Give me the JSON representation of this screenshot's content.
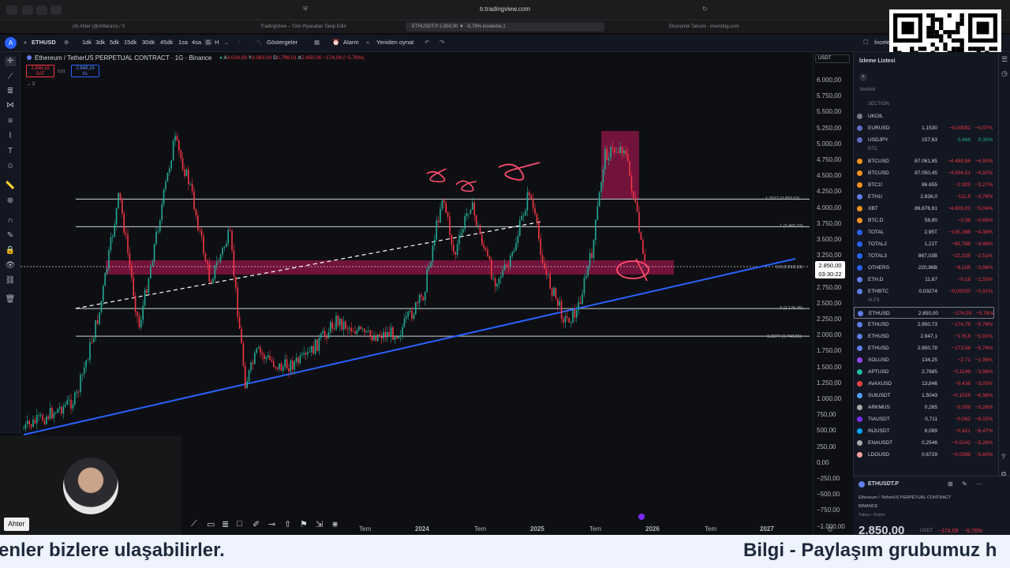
{
  "browser": {
    "url": "tr.tradingview.com",
    "tabs": [
      {
        "label": "(4) Ahter (@Ahterars) / X"
      },
      {
        "label": "TradingView – Tüm Piyasaları Takip Edin"
      },
      {
        "label": "ETHUSDT.P 2.850,00 ▼ −5,76% inceleme 2"
      },
      {
        "label": "Ekonomik Takvim - investing.com"
      }
    ]
  },
  "toolbar": {
    "symbol": "ETHUSD",
    "intervals": [
      "1dk",
      "3dk",
      "5dk",
      "15dk",
      "30dk",
      "45dk",
      "1sa",
      "4sa",
      "G",
      "H"
    ],
    "selected_interval": "G",
    "indicators_label": "Göstergeler",
    "alarm_label": "Alarm",
    "replay_label": "Yeniden oynat",
    "right_label": "İnceleme 2"
  },
  "legend": {
    "title": "Ethereum / TetherUS PERPETUAL CONTRACT · 1G · Binance",
    "ohlc": [
      {
        "k": "A",
        "v": "3.024,09"
      },
      {
        "k": "Y",
        "v": "3.063,00"
      },
      {
        "k": "D",
        "v": "2.798,01"
      },
      {
        "k": "K",
        "v": "2.850,00"
      }
    ],
    "change": "−174,09 (−5,76%)",
    "sell_price": "2.848,16",
    "sell_label": "SAT",
    "spread": "0,01",
    "buy_price": "2.848,16",
    "buy_label": "AL",
    "indicator_count": "3"
  },
  "price_scale": {
    "currency": "USDT",
    "labels": [
      "6.000,00",
      "5.750,00",
      "5.500,00",
      "5.250,00",
      "5.000,00",
      "4.750,00",
      "4.500,00",
      "4.250,00",
      "4.000,00",
      "3.750,00",
      "3.500,00",
      "3.250,00",
      "3.000,00",
      "2.750,00",
      "2.500,00",
      "2.250,00",
      "2.000,00",
      "1.750,00",
      "1.500,00",
      "1.250,00",
      "1.000,00",
      "750,00",
      "500,00",
      "250,00",
      "0,00",
      "−250,00",
      "−500,00",
      "−750,00",
      "−1.000,00"
    ],
    "current_price": "2.850,00",
    "countdown": "03:30:22"
  },
  "time_axis": [
    "Tem",
    "2024",
    "Tem",
    "2025",
    "Tem",
    "2026",
    "Tem",
    "2027"
  ],
  "fib_labels": [
    {
      "text": "1,3377 (3.893,53)"
    },
    {
      "text": "1 (3.460,03)"
    },
    {
      "text": "0,5 (2.818,18)"
    },
    {
      "text": "0 (2.176,35)"
    },
    {
      "text": "−0,3377 (1.742,85)"
    }
  ],
  "watchlist": {
    "title": "İzleme Listesi",
    "col_header": "Sembol",
    "sections": [
      {
        "name": "SECTION",
        "rows": [
          {
            "sym": "UKOIL",
            "last": "",
            "chg": "",
            "pct": "",
            "dir": "neg",
            "color": "#787b86"
          },
          {
            "sym": "EURUSD",
            "last": "1,1530",
            "chg": "−0,00082",
            "pct": "−0,07%",
            "dir": "neg",
            "color": "#5d6cc0"
          },
          {
            "sym": "USDJPY",
            "last": "157,63",
            "chg": "0,466",
            "pct": "0,30%",
            "dir": "pos",
            "color": "#5d6cc0"
          }
        ]
      },
      {
        "name": "BTC",
        "rows": [
          {
            "sym": "BTCUSD",
            "last": "87.061,85",
            "chg": "−4.489,66",
            "pct": "−4,90%",
            "dir": "neg",
            "color": "#f7931a"
          },
          {
            "sym": "BTCUSD",
            "last": "87.050,45",
            "chg": "−4.504,51",
            "pct": "−4,92%",
            "dir": "neg",
            "color": "#f7931a"
          },
          {
            "sym": "BTC1!",
            "last": "86.655",
            "chg": "−2.925",
            "pct": "−3,27%",
            "dir": "neg",
            "color": "#f7931a"
          },
          {
            "sym": "ETH1!",
            "last": "2.836,0",
            "chg": "−111,5",
            "pct": "−3,78%",
            "dir": "neg",
            "color": "#627eea"
          },
          {
            "sym": "XBT",
            "last": "86.876,91",
            "chg": "−4.608,02",
            "pct": "−5,04%",
            "dir": "neg",
            "color": "#f7931a"
          },
          {
            "sym": "BTC.D",
            "last": "58,90",
            "chg": "−0,38",
            "pct": "−0,65%",
            "dir": "neg",
            "color": "#f7931a"
          },
          {
            "sym": "TOTAL",
            "last": "2,95T",
            "chg": "−135,16B",
            "pct": "−4,38%",
            "dir": "neg",
            "color": "#2962ff"
          },
          {
            "sym": "TOTAL2",
            "last": "1,21T",
            "chg": "−43,76B",
            "pct": "−3,49%",
            "dir": "neg",
            "color": "#2962ff"
          },
          {
            "sym": "TOTAL3",
            "last": "867,03B",
            "chg": "−22,31B",
            "pct": "−2,51%",
            "dir": "neg",
            "color": "#2962ff"
          },
          {
            "sym": "OTHERS",
            "last": "220,96B",
            "chg": "−9,11B",
            "pct": "−3,96%",
            "dir": "neg",
            "color": "#2962ff"
          },
          {
            "sym": "ETH.D",
            "last": "11,67",
            "chg": "−0,18",
            "pct": "−1,55%",
            "dir": "neg",
            "color": "#627eea"
          },
          {
            "sym": "ETHBTC",
            "last": "0,03274",
            "chg": "−0,00030",
            "pct": "−0,91%",
            "dir": "neg",
            "color": "#627eea"
          }
        ]
      },
      {
        "name": "ALTS",
        "rows": [
          {
            "sym": "ETHUSD",
            "last": "2.850,00",
            "chg": "−174,09",
            "pct": "−5,76%",
            "dir": "neg",
            "color": "#627eea",
            "selected": true
          },
          {
            "sym": "ETHUSD",
            "last": "2.850,73",
            "chg": "−174,75",
            "pct": "−5,78%",
            "dir": "neg",
            "color": "#627eea"
          },
          {
            "sym": "ETHUSD",
            "last": "2.847,1",
            "chg": "−176,8",
            "pct": "−5,91%",
            "dir": "neg",
            "color": "#627eea"
          },
          {
            "sym": "ETHUSD",
            "last": "2.850,78",
            "chg": "−173,56",
            "pct": "−5,74%",
            "dir": "neg",
            "color": "#627eea"
          },
          {
            "sym": "SOLUSD",
            "last": "134,25",
            "chg": "−2,71",
            "pct": "−1,98%",
            "dir": "neg",
            "color": "#9945ff"
          },
          {
            "sym": "APTUSD",
            "last": "2,7685",
            "chg": "−0,1149",
            "pct": "−3,98%",
            "dir": "neg",
            "color": "#1abc9c"
          },
          {
            "sym": "AVAXUSD",
            "last": "13,846",
            "chg": "−0,436",
            "pct": "−3,05%",
            "dir": "neg",
            "color": "#e84142"
          },
          {
            "sym": "SUIUSDT",
            "last": "1,5043",
            "chg": "−0,1026",
            "pct": "−6,38%",
            "dir": "neg",
            "color": "#4da2ff"
          },
          {
            "sym": "ARKMUS",
            "last": "0,265",
            "chg": "−0,009",
            "pct": "−3,28%",
            "dir": "neg",
            "color": "#aaaaaa"
          },
          {
            "sym": "TIAUSDT",
            "last": "0,711",
            "chg": "−0,062",
            "pct": "−8,02%",
            "dir": "neg",
            "color": "#7b2bf9"
          },
          {
            "sym": "INJUSDT",
            "last": "6,089",
            "chg": "−0,421",
            "pct": "−6,47%",
            "dir": "neg",
            "color": "#00a3ff"
          },
          {
            "sym": "ENAUSDT",
            "last": "0,2546",
            "chg": "−0,0142",
            "pct": "−5,28%",
            "dir": "neg",
            "color": "#aaaaaa"
          },
          {
            "sym": "LDOUSD",
            "last": "0,6729",
            "chg": "−0,0398",
            "pct": "−5,60%",
            "dir": "neg",
            "color": "#f7a4a4"
          }
        ]
      }
    ]
  },
  "details": {
    "symbol": "ETHUSDT.P",
    "name": "Ethereum / TetherUS PERPETUAL CONTRACT",
    "exchange": "BINANCE",
    "type": "Takas • Kripto",
    "price": "2.850,00",
    "currency": "USDT",
    "change": "−174,09",
    "pct": "−5,76%"
  },
  "webcam": {
    "name": "Ahter"
  },
  "ticker": {
    "left": "enler bizlere ulaşabilirler.",
    "right": "Bilgi - Paylaşım grubumuz h"
  },
  "colors": {
    "up": "#22ab94",
    "down": "#f23645",
    "trendline": "#2962ff",
    "zone": "#c2185b",
    "annotation": "#ff4d6d"
  }
}
